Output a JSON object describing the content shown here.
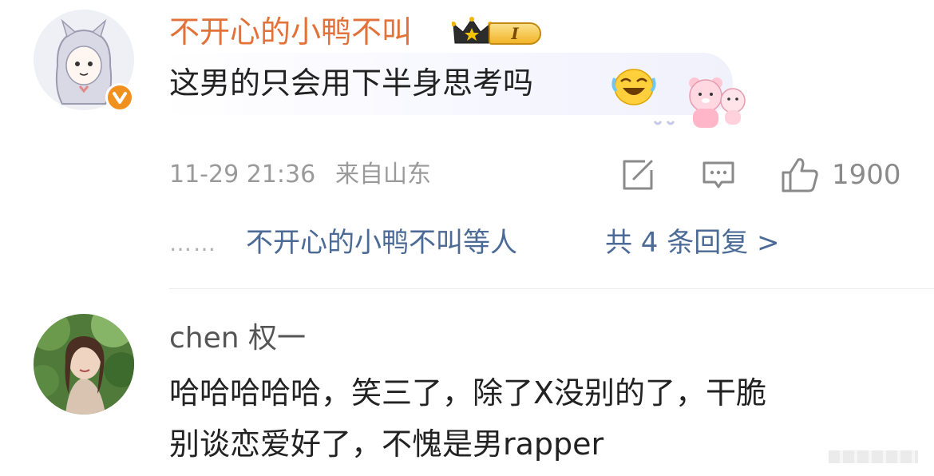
{
  "comment1": {
    "username": "不开心的小鸭不叫",
    "badge_level": "I",
    "text": "这男的只会用下半身思考吗",
    "time": "11-29 21:36",
    "location": "来自山东",
    "like_count": "1900",
    "replies": {
      "dots": "……",
      "who": "不开心的小鸭不叫等人",
      "count_label": "共 4 条回复 >"
    }
  },
  "comment2": {
    "username": "chen 权一",
    "text_line1": "哈哈哈哈哈，笑三了，除了X没别的了，干脆",
    "text_line2": "别谈恋爱好了，不愧是男rapper"
  },
  "colors": {
    "username_orange": "#e3723a",
    "reply_link_blue": "#4b6a96",
    "meta_gray": "#9a9a9a",
    "verified_badge": "#f2901d"
  },
  "icons": [
    "crown-icon",
    "verified-icon",
    "emoji-laugh-cry-icon",
    "bear-sticker-icon",
    "share-icon",
    "comment-icon",
    "like-icon"
  ]
}
